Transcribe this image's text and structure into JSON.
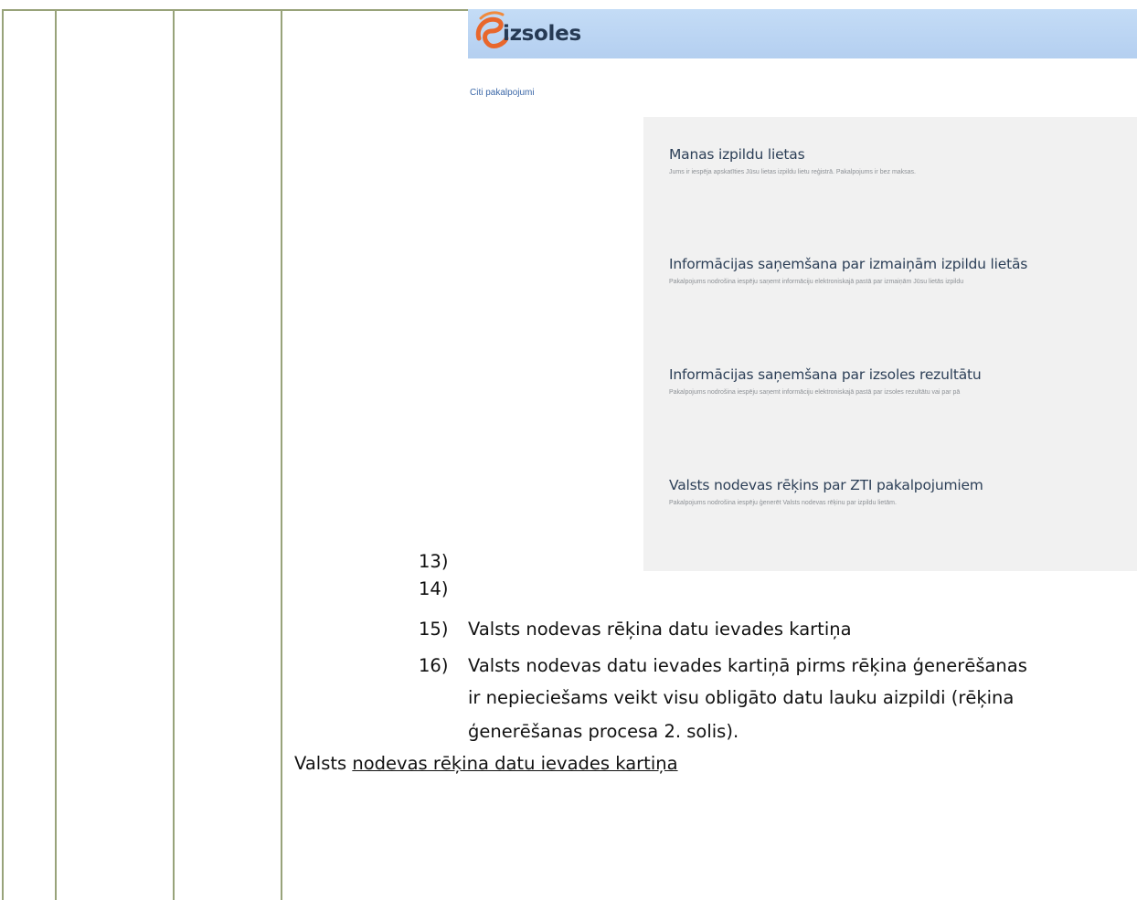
{
  "screenshot": {
    "logo_text": "izsoles",
    "breadcrumb": "Citi pakalpojumi",
    "services": [
      {
        "title": "Manas izpildu lietas",
        "desc": "Jums ir iespēja apskatīties Jūsu lietas izpildu lietu reģistrā. Pakalpojums ir bez maksas."
      },
      {
        "title": "Informācijas saņemšana par izmaiņām izpildu lietās",
        "desc": "Pakalpojums nodrošina iespēju saņemt informāciju elektroniskajā pastā par izmaiņām Jūsu lietās izpildu"
      },
      {
        "title": "Informācijas saņemšana par izsoles rezultātu",
        "desc": "Pakalpojums nodrošina iespēju saņemt informāciju elektroniskajā pastā par izsoles rezultātu vai par pā"
      },
      {
        "title": "Valsts nodevas rēķins par ZTI pakalpojumiem",
        "desc": "Pakalpojums nodrošina iespēju ģenerēt Valsts nodevas rēķinu par izpildu lietām."
      }
    ]
  },
  "list": [
    {
      "num": "13)",
      "text": ""
    },
    {
      "num": "14)",
      "text": ""
    },
    {
      "num": "15)",
      "text": "Valsts nodevas rēķina datu ievades kartiņa"
    },
    {
      "num": "16)",
      "text": "Valsts nodevas datu ievades kartiņā pirms rēķina ģenerēšanas"
    }
  ],
  "list_continuation": [
    "ir nepieciešams veikt visu obligāto datu lauku aizpildi (rēķina",
    "ģenerēšanas procesa 2. solis)."
  ],
  "caption": {
    "plain": "Valsts ",
    "underlined": "nodevas rēķina datu ievades kartiņa"
  }
}
